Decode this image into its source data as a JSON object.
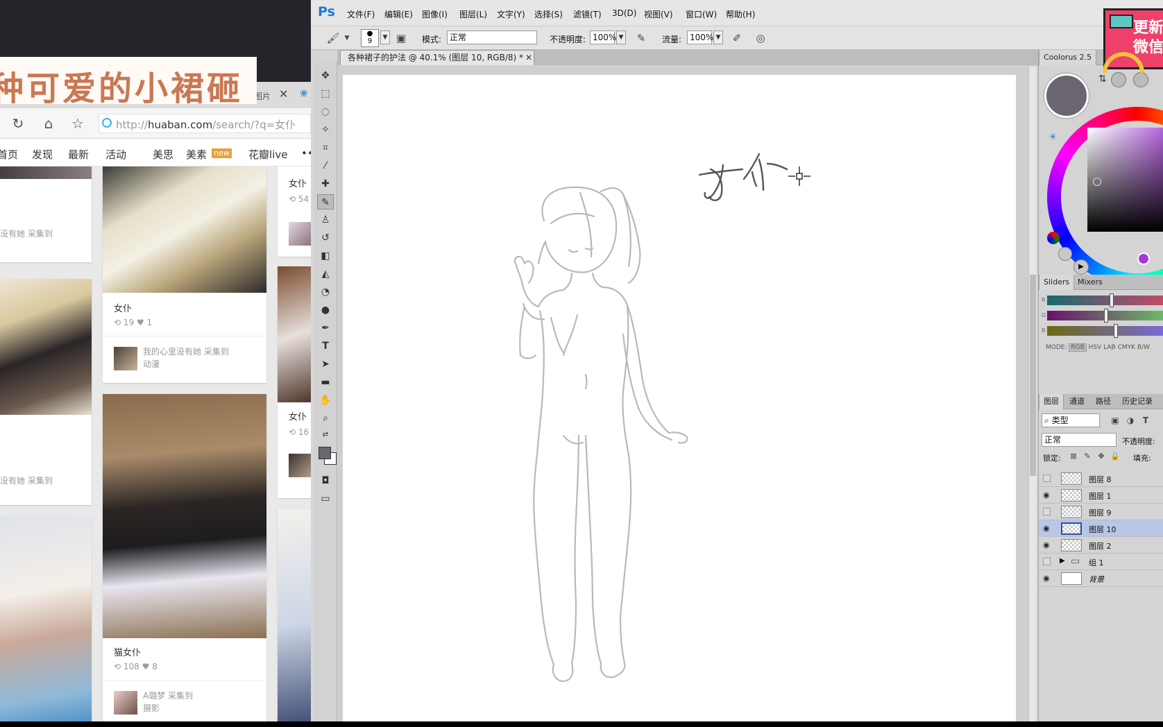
{
  "banner": {
    "text": "种可爱的小裙砸"
  },
  "browser": {
    "tab_title": "图片",
    "url_host": "huaban.com",
    "url_protocol": "http://",
    "url_path": "/search/?q=女仆",
    "nav": [
      "首页",
      "发现",
      "最新",
      "活动",
      "美思",
      "美素",
      "花瓣live"
    ],
    "nav_badge": "new",
    "cards": {
      "left_note_1": "没有她 采集到",
      "left_note_2": "没有她 采集到",
      "mid1_title": "女仆",
      "mid1_stats": "19",
      "mid1_likes": "1",
      "mid1_note": "我的心里没有她 采集到",
      "mid1_board": "动漫",
      "mid2_title": "猫女仆",
      "mid2_stats": "108",
      "mid2_likes": "8",
      "mid2_note": "A璐梦 采集到",
      "mid2_board": "摄影",
      "right1_title": "女仆",
      "right1_stats": "54",
      "right2_title": "女仆",
      "right2_stats": "16"
    }
  },
  "ps": {
    "logo": "Ps",
    "menu": [
      "文件(F)",
      "编辑(E)",
      "图像(I)",
      "图层(L)",
      "文字(Y)",
      "选择(S)",
      "滤镜(T)",
      "3D(D)",
      "视图(V)",
      "窗口(W)",
      "帮助(H)"
    ],
    "options": {
      "brush_size": "9",
      "mode_label": "模式:",
      "mode_value": "正常",
      "opacity_label": "不透明度:",
      "opacity_value": "100%",
      "flow_label": "流量:",
      "flow_value": "100%"
    },
    "doc_tab": "各种裙子的护法 @ 40.1% (图层 10, RGB/8) *",
    "canvas_text": "女仆",
    "coolorus": {
      "tab": "Coolorus 2.5",
      "sliders_tab": "Sliders",
      "mixers_tab": "Mixers",
      "slider_letters": [
        "R",
        "G",
        "B"
      ],
      "modes": [
        "MODE:",
        "RGB",
        "HSV",
        "LAB",
        "CMYK",
        "B/W"
      ],
      "current_color": "#6b6570"
    },
    "layers_panel": {
      "tabs": [
        "图层",
        "通道",
        "路径",
        "历史记录"
      ],
      "filter": "类型",
      "blend": "正常",
      "opacity_label": "不透明度:",
      "lock_label": "锁定:",
      "fill_label": "填充:",
      "layers": [
        {
          "name": "图层 8",
          "visible": false,
          "active": false
        },
        {
          "name": "图层 1",
          "visible": true,
          "active": false
        },
        {
          "name": "图层 9",
          "visible": false,
          "active": false
        },
        {
          "name": "图层 10",
          "visible": true,
          "active": true
        },
        {
          "name": "图层 2",
          "visible": true,
          "active": false
        },
        {
          "name": "组 1",
          "visible": false,
          "active": false
        },
        {
          "name": "背景",
          "visible": true,
          "active": false
        }
      ]
    }
  },
  "sticker": {
    "line1": "更新",
    "line2": "微信"
  }
}
